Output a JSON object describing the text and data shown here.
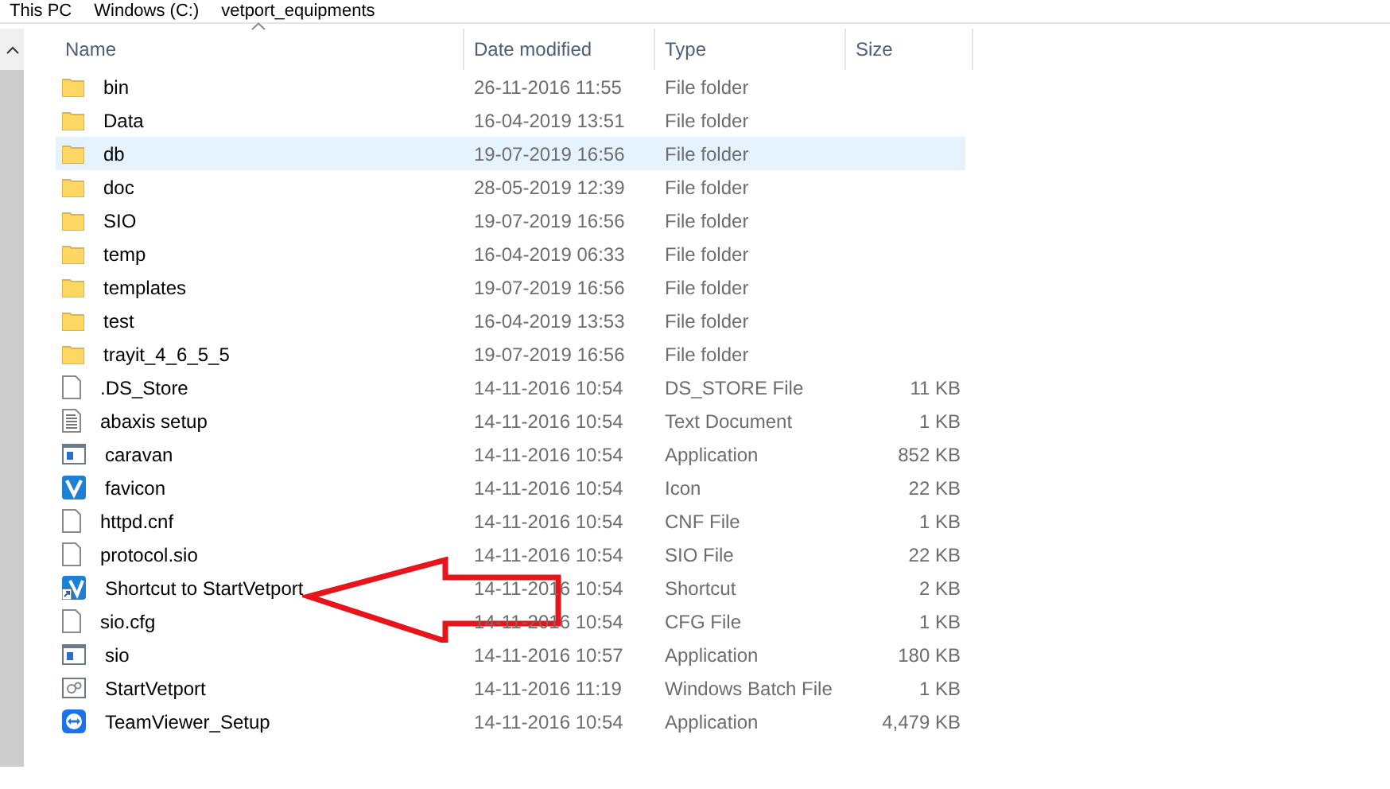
{
  "breadcrumb": [
    "This PC",
    "Windows (C:)",
    "vetport_equipments"
  ],
  "columns": [
    {
      "label": "Name",
      "sorted": true
    },
    {
      "label": "Date modified",
      "sorted": false
    },
    {
      "label": "Type",
      "sorted": false
    },
    {
      "label": "Size",
      "sorted": false
    }
  ],
  "rows": [
    {
      "kind": "folder",
      "name": "bin",
      "date": "26-11-2016 11:55",
      "type": "File folder",
      "selected": false
    },
    {
      "kind": "folder",
      "name": "Data",
      "date": "16-04-2019 13:51",
      "type": "File folder",
      "selected": false
    },
    {
      "kind": "folder",
      "name": "db",
      "date": "19-07-2019 16:56",
      "type": "File folder",
      "selected": true
    },
    {
      "kind": "folder",
      "name": "doc",
      "date": "28-05-2019 12:39",
      "type": "File folder",
      "selected": false
    },
    {
      "kind": "folder",
      "name": "SIO",
      "date": "19-07-2019 16:56",
      "type": "File folder",
      "selected": false
    },
    {
      "kind": "folder",
      "name": "temp",
      "date": "16-04-2019 06:33",
      "type": "File folder",
      "selected": false
    },
    {
      "kind": "folder",
      "name": "templates",
      "date": "19-07-2019 16:56",
      "type": "File folder",
      "selected": false
    },
    {
      "kind": "folder",
      "name": "test",
      "date": "16-04-2019 13:53",
      "type": "File folder",
      "selected": false
    },
    {
      "kind": "folder",
      "name": "trayit_4_6_5_5",
      "date": "19-07-2019 16:56",
      "type": "File folder",
      "selected": false
    },
    {
      "kind": "file",
      "name": ".DS_Store",
      "date": "14-11-2016 10:54",
      "type": "DS_STORE File",
      "size": "11 KB",
      "selected": false
    },
    {
      "kind": "text",
      "name": "abaxis setup",
      "date": "14-11-2016 10:54",
      "type": "Text Document",
      "size": "1 KB",
      "selected": false
    },
    {
      "kind": "app",
      "name": "caravan",
      "date": "14-11-2016 10:54",
      "type": "Application",
      "size": "852 KB",
      "selected": false
    },
    {
      "kind": "logo",
      "name": "favicon",
      "date": "14-11-2016 10:54",
      "type": "Icon",
      "size": "22 KB",
      "selected": false
    },
    {
      "kind": "file",
      "name": "httpd.cnf",
      "date": "14-11-2016 10:54",
      "type": "CNF File",
      "size": "1 KB",
      "selected": false
    },
    {
      "kind": "file",
      "name": "protocol.sio",
      "date": "14-11-2016 10:54",
      "type": "SIO File",
      "size": "22 KB",
      "selected": false
    },
    {
      "kind": "shortcut",
      "name": "Shortcut to StartVetport",
      "date": "14-11-2016 10:54",
      "type": "Shortcut",
      "size": "2 KB",
      "selected": false
    },
    {
      "kind": "file",
      "name": "sio.cfg",
      "date": "14-11-2016 10:54",
      "type": "CFG File",
      "size": "1 KB",
      "selected": false
    },
    {
      "kind": "app",
      "name": "sio",
      "date": "14-11-2016 10:57",
      "type": "Application",
      "size": "180 KB",
      "selected": false
    },
    {
      "kind": "batch",
      "name": "StartVetport",
      "date": "14-11-2016 11:19",
      "type": "Windows Batch File",
      "size": "1 KB",
      "selected": false
    },
    {
      "kind": "teamviewer",
      "name": "TeamViewer_Setup",
      "date": "14-11-2016 10:54",
      "type": "Application",
      "size": "4,479 KB",
      "selected": false
    }
  ]
}
